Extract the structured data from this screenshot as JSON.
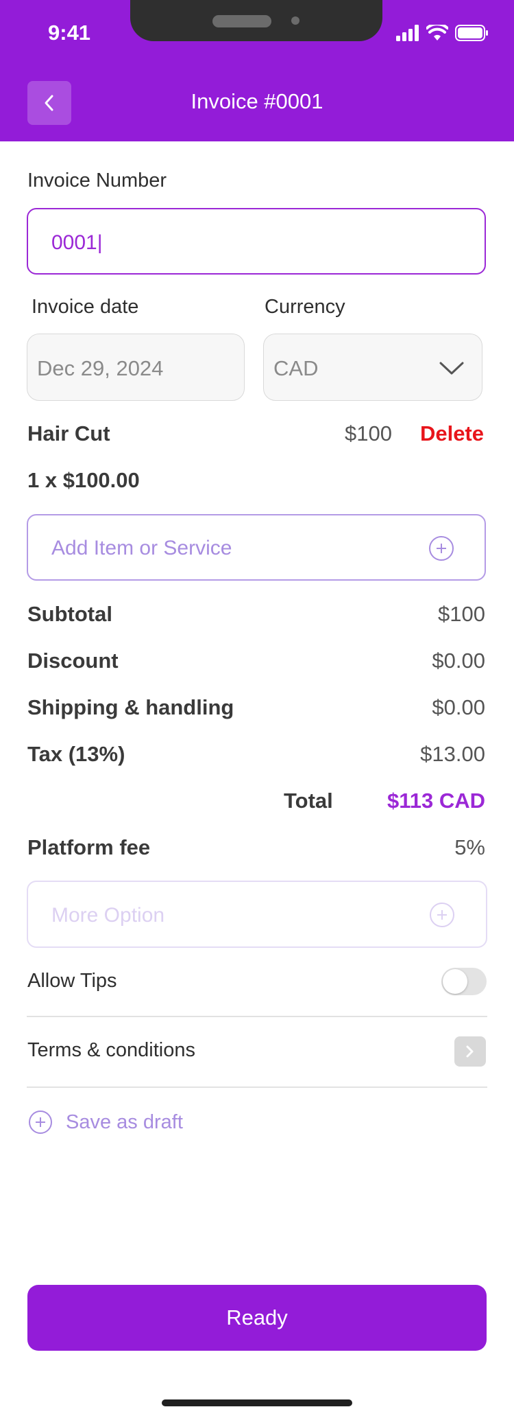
{
  "status_bar": {
    "time": "9:41"
  },
  "header": {
    "title": "Invoice #0001",
    "back_icon": "chevron-left-icon"
  },
  "invoice_number": {
    "label": "Invoice Number",
    "value": "0001|"
  },
  "invoice_date": {
    "label": "Invoice date",
    "value": "Dec 29, 2024"
  },
  "currency": {
    "label": "Currency",
    "value": "CAD"
  },
  "item": {
    "name": "Hair Cut",
    "amount": "$100",
    "delete_label": "Delete",
    "quantity_line": "1 x $100.00"
  },
  "add_item": {
    "placeholder": "Add Item or Service"
  },
  "summary": {
    "subtotal_label": "Subtotal",
    "subtotal_value": "$100",
    "discount_label": "Discount",
    "discount_value": "$0.00",
    "shipping_label": "Shipping & handling",
    "shipping_value": "$0.00",
    "tax_label": "Tax (13%)",
    "tax_value": "$13.00",
    "total_label": "Total",
    "total_value": "$113 CAD",
    "platform_fee_label": "Platform fee",
    "platform_fee_value": "5%"
  },
  "more_option": {
    "placeholder": "More Option"
  },
  "allow_tips": {
    "label": "Allow Tips",
    "enabled": false
  },
  "terms": {
    "label": "Terms & conditions"
  },
  "save_draft": {
    "label": "Save as draft"
  },
  "ready_button": {
    "label": "Ready"
  },
  "colors": {
    "brand": "#931CD8",
    "delete": "#E8151B",
    "total": "#9B28D6"
  }
}
